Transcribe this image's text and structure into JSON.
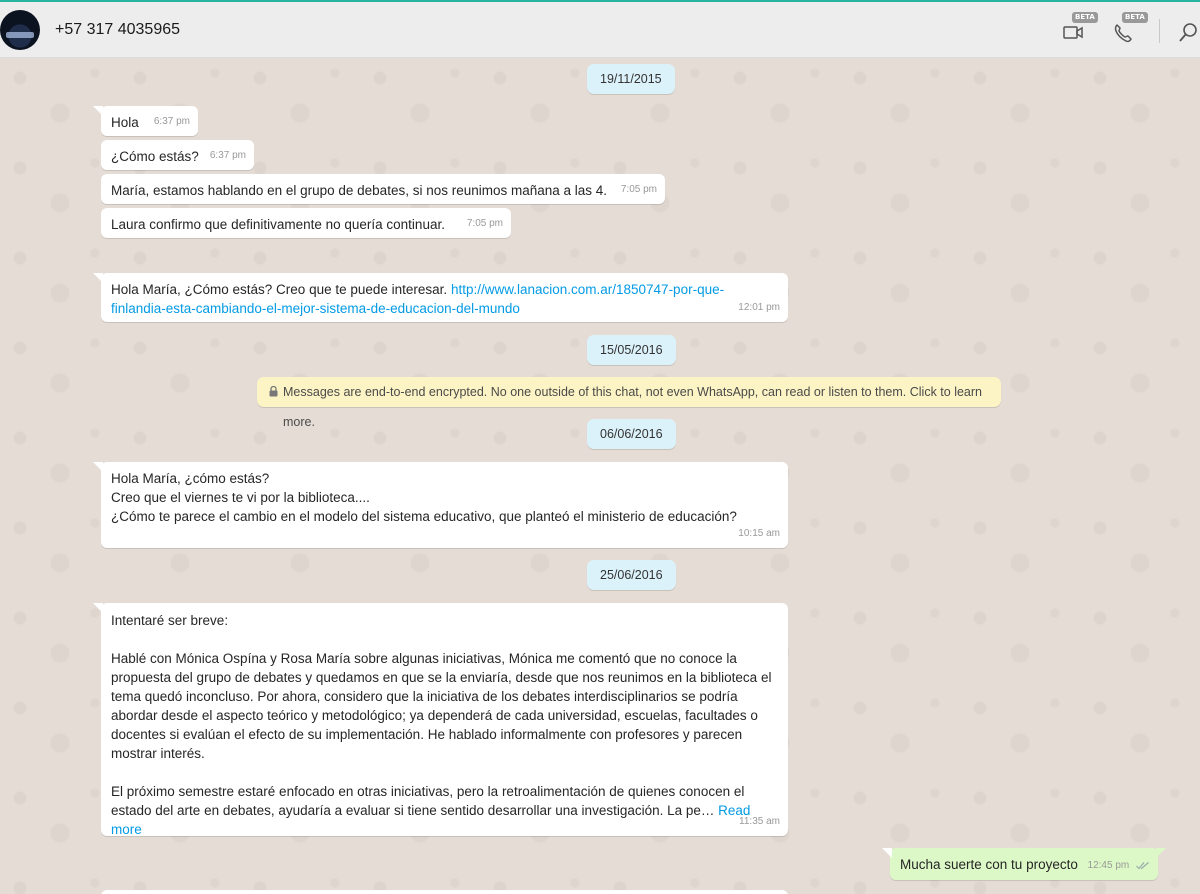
{
  "header": {
    "contact_name": "+57 317 4035965",
    "video_beta": "BETA",
    "call_beta": "BETA"
  },
  "chat": {
    "date_1": "19/11/2015",
    "date_2": "15/05/2016",
    "date_3": "06/06/2016",
    "date_4": "25/06/2016",
    "encryption_notice": "Messages are end-to-end encrypted. No one outside of this chat, not even WhatsApp, can read or listen to them. Click to learn more.",
    "messages": [
      {
        "text": "Hola",
        "time": "6:37 pm"
      },
      {
        "text": "¿Cómo estás?",
        "time": "6:37 pm"
      },
      {
        "text": "María, estamos hablando en el grupo de debates, si nos reunimos mañana a las 4.",
        "time": "7:05 pm"
      },
      {
        "text": "Laura confirmo que definitivamente no quería continuar.",
        "time": "7:05 pm"
      },
      {
        "text": "Hola María, ¿Cómo estás? Creo que te puede interesar. ",
        "link_1": "http://www.lanacion.com.ar/1850747-por-que-",
        "link_2": "finlandia-esta-cambiando-el-mejor-sistema-de-educacion-del-mundo",
        "time": "12:01 pm"
      },
      {
        "line_1": "Hola María, ¿cómo estás?",
        "line_2": "Creo que el viernes te vi por la biblioteca....",
        "line_3": "¿Cómo te parece el cambio en el modelo del sistema educativo, que planteó el ministerio de educación?",
        "time": "10:15 am"
      },
      {
        "para_1": "Intentaré ser breve:",
        "para_2": "Hablé con Mónica Ospína y Rosa María sobre algunas iniciativas, Mónica me comentó que no conoce la propuesta del grupo de debates y quedamos en que se la enviaría, desde que nos reunimos en la biblioteca el tema quedó inconcluso. Por ahora, considero que la iniciativa de los debates interdisciplinarios se podría abordar desde el aspecto teórico y metodológico; ya dependerá de cada universidad, escuelas, facultades o docentes si evalúan el efecto de su implementación. He hablado informalmente con profesores y parecen mostrar interés.",
        "para_3": "El próximo semestre estaré enfocado en otras iniciativas, pero la retroalimentación de quienes conocen el estado del arte en debates, ayudaría a evaluar si tiene sentido desarrollar una investigación. La pe…",
        "read_more": "Read more",
        "time": "11:35 am"
      },
      {
        "text": "Mucha suerte con tu proyecto",
        "time": "12:45 pm"
      }
    ]
  },
  "colors": {
    "accent": "#26b3a1",
    "outgoing_bubble": "#dcf8c6",
    "incoming_bubble": "#ffffff",
    "date_chip": "#dcf2fa",
    "encryption_notice": "#fdf4c5",
    "link": "#039be5"
  },
  "icons": [
    "video-call-icon",
    "voice-call-icon",
    "search-icon",
    "lock-icon",
    "double-check-icon"
  ]
}
